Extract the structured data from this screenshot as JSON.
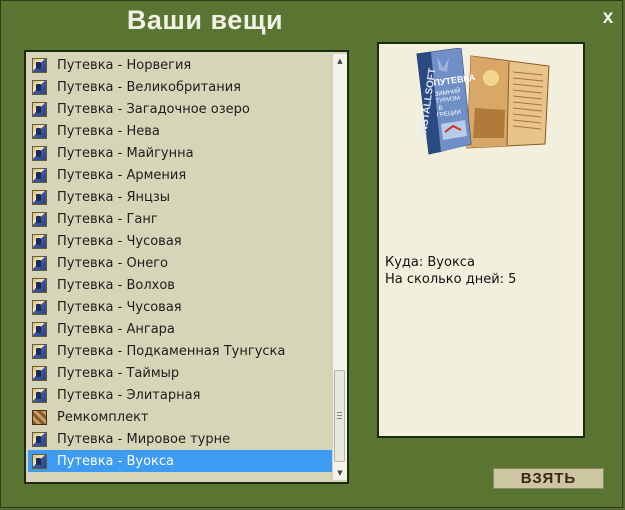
{
  "window": {
    "title": "Ваши вещи",
    "close_label": "x"
  },
  "list": {
    "items": [
      {
        "label": "Путевка - Норвегия",
        "icon": "ticket-icon"
      },
      {
        "label": "Путевка - Великобритания",
        "icon": "ticket-icon"
      },
      {
        "label": "Путевка - Загадочное озеро",
        "icon": "ticket-icon"
      },
      {
        "label": "Путевка - Нева",
        "icon": "ticket-icon"
      },
      {
        "label": "Путевка - Майгунна",
        "icon": "ticket-icon"
      },
      {
        "label": "Путевка - Армения",
        "icon": "ticket-icon"
      },
      {
        "label": "Путевка - Янцзы",
        "icon": "ticket-icon"
      },
      {
        "label": "Путевка - Ганг",
        "icon": "ticket-icon"
      },
      {
        "label": "Путевка - Чусовая",
        "icon": "ticket-icon"
      },
      {
        "label": "Путевка - Онего",
        "icon": "ticket-icon"
      },
      {
        "label": "Путевка - Волхов",
        "icon": "ticket-icon"
      },
      {
        "label": "Путевка - Чусовая",
        "icon": "ticket-icon"
      },
      {
        "label": "Путевка - Ангара",
        "icon": "ticket-icon"
      },
      {
        "label": "Путевка - Подкаменная Тунгуска",
        "icon": "ticket-icon"
      },
      {
        "label": "Путевка - Таймыр",
        "icon": "ticket-icon"
      },
      {
        "label": "Путевка - Элитарная",
        "icon": "ticket-icon"
      },
      {
        "label": "Ремкомплект",
        "icon": "repair-kit-icon"
      },
      {
        "label": "Путевка - Мировое турне",
        "icon": "ticket-icon"
      },
      {
        "label": "Путевка - Вуокса",
        "icon": "ticket-icon",
        "selected": true
      }
    ]
  },
  "detail": {
    "brochure": {
      "vertical_text": "INSTALLSOFT",
      "title_text": "ПУТЕВКА",
      "sub1": "ЗИМНИЙ",
      "sub2": "ТУРИЗМ",
      "sub3": "В",
      "sub4": "ГРЕЦИИ"
    },
    "destination_line": "Куда: Вуокса",
    "days_line": "На сколько дней: 5"
  },
  "actions": {
    "take_label": "ВЗЯТЬ"
  },
  "colors": {
    "frame": "#5a7532",
    "list_bg": "#d6d5b7",
    "selection": "#3d9bf2",
    "detail_bg": "#f2f0dc"
  }
}
